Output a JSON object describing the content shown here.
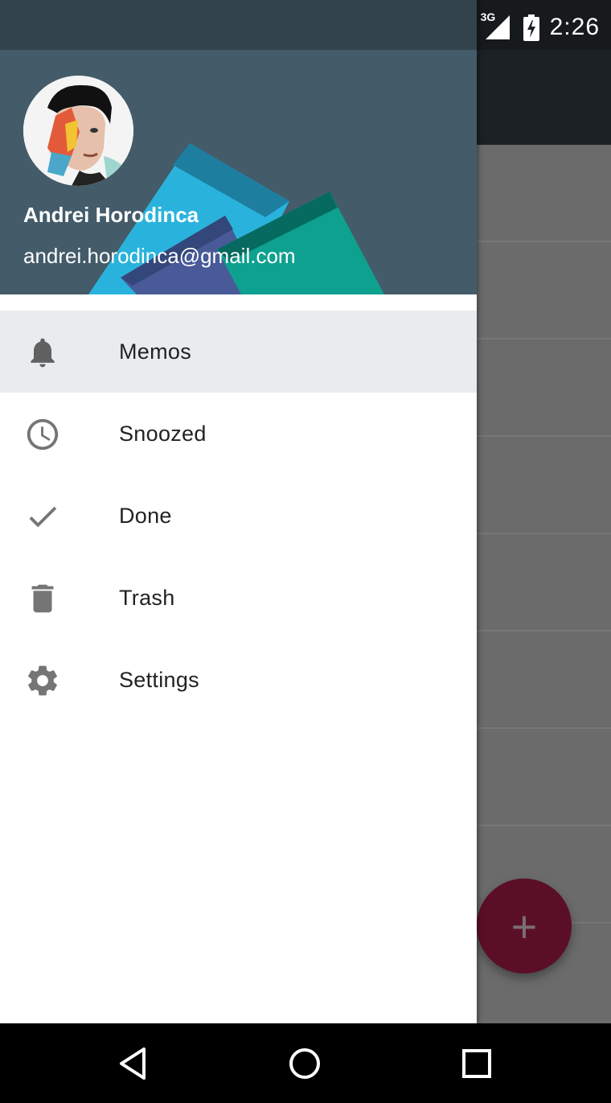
{
  "status_bar": {
    "network": "3G",
    "time": "2:26"
  },
  "drawer": {
    "user": {
      "name": "Andrei Horodinca",
      "email": "andrei.horodinca@gmail.com"
    },
    "items": [
      {
        "label": "Memos",
        "icon": "bell-icon",
        "active": true
      },
      {
        "label": "Snoozed",
        "icon": "clock-icon",
        "active": false
      },
      {
        "label": "Done",
        "icon": "check-icon",
        "active": false
      },
      {
        "label": "Trash",
        "icon": "trash-icon",
        "active": false
      },
      {
        "label": "Settings",
        "icon": "gear-icon",
        "active": false
      }
    ]
  },
  "fab": {
    "icon": "plus-icon",
    "symbol": "+",
    "color": "#5b0f26"
  },
  "colors": {
    "header_bg": "#445b69",
    "active_item_bg": "#e8ecef",
    "icon_gray": "#757575"
  },
  "nav_bar": {
    "buttons": [
      "back",
      "home",
      "recents"
    ]
  }
}
